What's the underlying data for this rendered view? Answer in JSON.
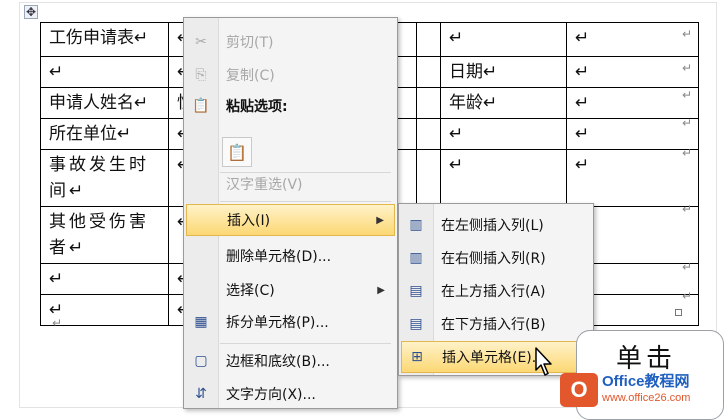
{
  "document": {
    "move_handle_glyph": "✥",
    "rows": [
      [
        "工伤申请表↵",
        "↵",
        "",
        "",
        "↵",
        "↵"
      ],
      [
        "↵",
        "↵",
        "",
        "",
        "日期↵",
        "↵"
      ],
      [
        "申请人姓名↵",
        "性",
        "",
        "",
        "年龄↵",
        "↵"
      ],
      [
        "所在单位↵",
        "↵",
        "",
        "",
        "↵",
        "↵"
      ],
      [
        "事故发生时间↵",
        "↵",
        "",
        "",
        "↵",
        "↵"
      ],
      [
        "其他受伤害者↵",
        "↵",
        "",
        "",
        "↵",
        "↵"
      ],
      [
        "↵",
        "↵",
        "",
        "",
        "↵",
        "↵"
      ],
      [
        "↵",
        "↵",
        "",
        "",
        "↵",
        "↵"
      ]
    ],
    "row_end_mark": "↵",
    "paragraph_mark": "↵"
  },
  "context_menu": {
    "items": [
      {
        "label": "剪切(T)",
        "icon": "scissors-icon",
        "glyph": "✂",
        "disabled": true
      },
      {
        "label": "复制(C)",
        "icon": "copy-icon",
        "glyph": "⎘",
        "disabled": true
      },
      {
        "label": "粘贴选项:",
        "icon": "paste-icon",
        "glyph": "📋",
        "bold": true
      },
      {
        "label": "汉字重选(V)",
        "disabled": true
      },
      {
        "label": "插入(I)",
        "highlighted": true,
        "submenu": true
      },
      {
        "label": "删除单元格(D)..."
      },
      {
        "label": "选择(C)",
        "submenu": true
      },
      {
        "label": "拆分单元格(P)...",
        "icon": "split-cells-icon",
        "glyph": "▦"
      },
      {
        "label": "边框和底纹(B)...",
        "icon": "borders-icon",
        "glyph": "▢"
      },
      {
        "label": "文字方向(X)...",
        "icon": "text-direction-icon",
        "glyph": "⇵"
      }
    ],
    "paste_option_glyph": "📋"
  },
  "insert_submenu": {
    "items": [
      {
        "label": "在左侧插入列(L)",
        "icon": "insert-column-left-icon",
        "glyph": "▥"
      },
      {
        "label": "在右侧插入列(R)",
        "icon": "insert-column-right-icon",
        "glyph": "▥"
      },
      {
        "label": "在上方插入行(A)",
        "icon": "insert-row-above-icon",
        "glyph": "▤"
      },
      {
        "label": "在下方插入行(B)",
        "icon": "insert-row-below-icon",
        "glyph": "▤"
      },
      {
        "label": "插入单元格(E)...",
        "icon": "insert-cells-icon",
        "glyph": "⊞",
        "highlighted": true
      }
    ]
  },
  "callout": {
    "text": "单击"
  },
  "watermark": {
    "logo": "O",
    "name": "Office教程网",
    "url": "www.office26.com"
  },
  "colors": {
    "highlight": "#fcd874",
    "menu_bg": "#f4f4f4",
    "accent": "#2d4f8f",
    "watermark_orange": "#e2572c"
  }
}
